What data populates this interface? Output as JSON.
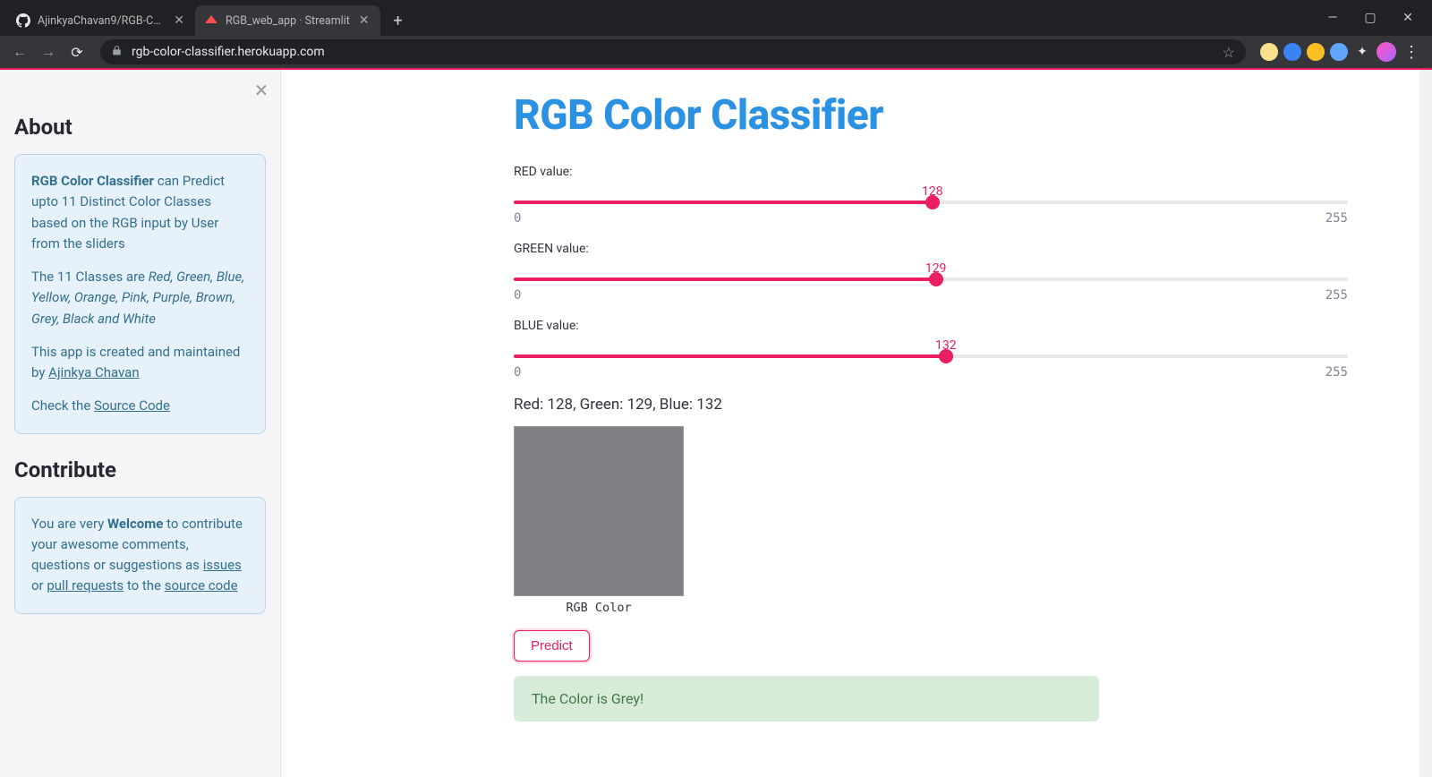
{
  "browser": {
    "tabs": [
      {
        "title": "AjinkyaChavan9/RGB-Color-Class",
        "active": false
      },
      {
        "title": "RGB_web_app · Streamlit",
        "active": true
      }
    ],
    "new_tab": "+",
    "window": {
      "min": "—",
      "max": "▢",
      "close": "✕"
    },
    "nav": {
      "back": "←",
      "forward": "→",
      "reload": "⟳"
    },
    "url": "rgb-color-classifier.herokuapp.com",
    "star": "☆",
    "extensions": [
      {
        "color": "#f9e28c"
      },
      {
        "color": "#3b82f6"
      },
      {
        "color": "#fbbf24"
      },
      {
        "color": "#60a5fa"
      }
    ],
    "puzzle": "✦",
    "kebab": "⋮"
  },
  "sidebar": {
    "close": "×",
    "about_heading": "About",
    "about_strong": "RGB Color Classifier",
    "about_p1b": " can Predict upto 11 Distinct Color Classes based on the RGB input by User from the sliders",
    "about_p2a": "The 11 Classes are ",
    "about_p2_em": "Red, Green, Blue, Yellow, Orange, Pink, Purple, Brown, Grey, Black and White",
    "about_p3a": "This app is created and maintained by ",
    "about_p3_link": "Ajinkya Chavan",
    "about_p4a": "Check the ",
    "about_p4_link": "Source Code",
    "contribute_heading": "Contribute",
    "contrib_p_a": "You are very ",
    "contrib_strong": "Welcome",
    "contrib_p_b": " to contribute your awesome comments, questions or suggestions as ",
    "contrib_link1": "issues",
    "contrib_p_c": " or ",
    "contrib_link2": "pull requests",
    "contrib_p_d": " to the ",
    "contrib_link3": "source code"
  },
  "main": {
    "title": "RGB Color Classifier",
    "sliders": {
      "red": {
        "label": "RED value:",
        "value": 128,
        "min": 0,
        "max": 255
      },
      "green": {
        "label": "GREEN value:",
        "value": 129,
        "min": 0,
        "max": 255
      },
      "blue": {
        "label": "BLUE value:",
        "value": 132,
        "min": 0,
        "max": 255
      }
    },
    "rgb_text": "Red: 128, Green: 129, Blue: 132",
    "swatch_caption": "RGB Color",
    "swatch_hex": "#808184",
    "predict_label": "Predict",
    "result_text": "The Color is Grey!"
  }
}
